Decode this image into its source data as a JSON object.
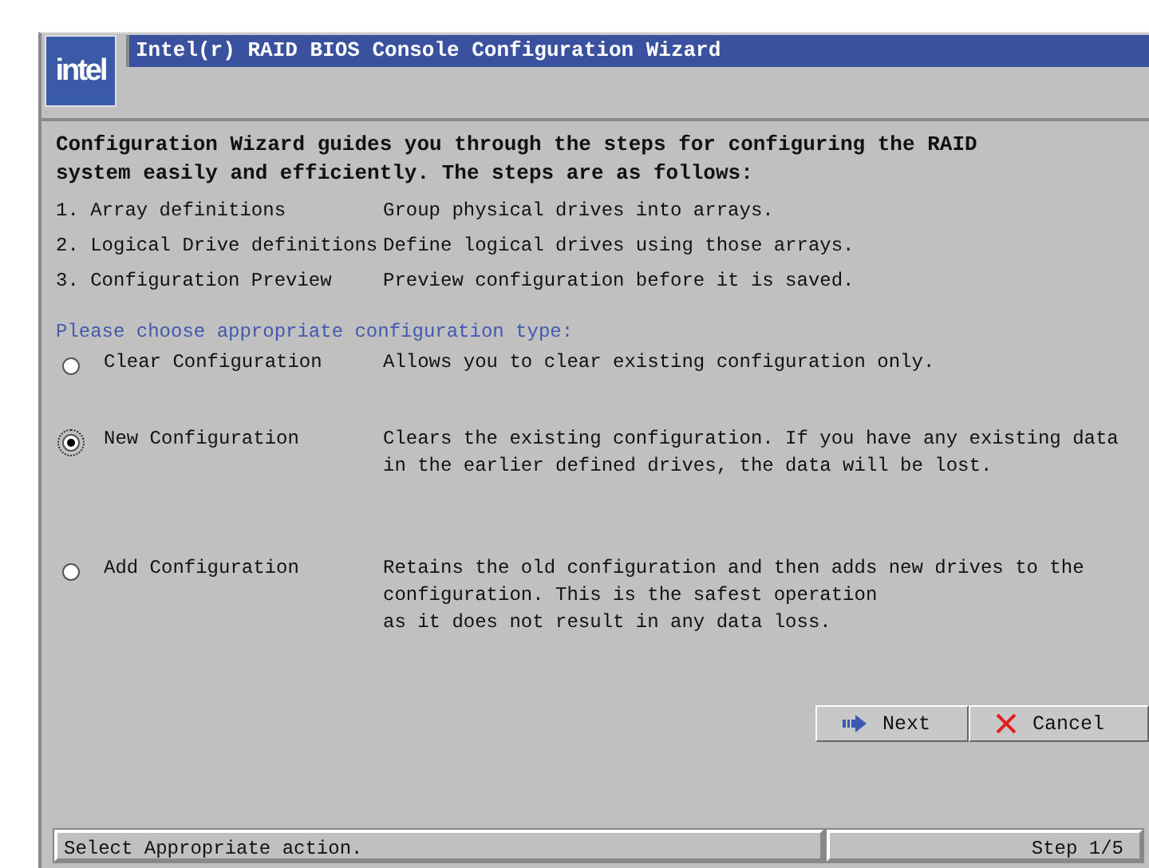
{
  "window": {
    "title": "Intel(r) RAID BIOS Console Configuration Wizard",
    "logo": "intel"
  },
  "intro": "Configuration Wizard guides you through the steps for configuring the RAID system easily and efficiently. The steps are as follows:",
  "steps": [
    {
      "name": "1. Array definitions",
      "description": "Group physical drives into arrays."
    },
    {
      "name": "2. Logical Drive definitions",
      "description": "Define logical drives using those arrays."
    },
    {
      "name": "3. Configuration Preview",
      "description": "Preview configuration before it is saved."
    }
  ],
  "prompt": "Please choose appropriate configuration type:",
  "options": [
    {
      "label": "Clear Configuration",
      "selected": false,
      "description": [
        "Allows you to clear existing configuration only."
      ]
    },
    {
      "label": "New Configuration",
      "selected": true,
      "description": [
        "Clears the existing configuration. If you have any existing data",
        "in the earlier defined drives, the data will be lost."
      ]
    },
    {
      "label": "Add Configuration",
      "selected": false,
      "description": [
        "Retains the old configuration and then adds new drives to the",
        "configuration. This is the safest operation",
        "as it does not result in any data loss."
      ]
    }
  ],
  "buttons": [
    {
      "kind": "next",
      "label": "Next"
    },
    {
      "kind": "cancel",
      "label": "Cancel"
    }
  ],
  "status_bar": {
    "message": "Select Appropriate action.",
    "step": "Step 1/5"
  }
}
